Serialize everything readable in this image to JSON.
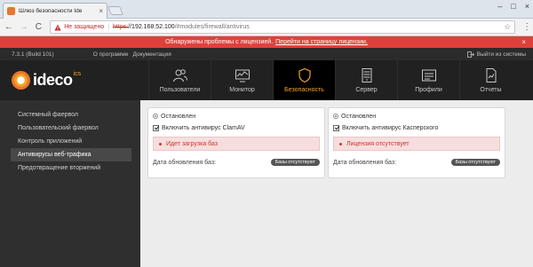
{
  "browser": {
    "tab_title": "Шлюз безопасности Ide",
    "tab_close": "×",
    "back": "←",
    "forward": "→",
    "reload": "C",
    "not_secure": "Не защищено",
    "separator": "|",
    "url_protocol": "https:",
    "url_host": "//192.168.52.100",
    "url_path": "/#modules/firewall/antivirus",
    "star": "☆",
    "menu": "⋮",
    "win_minimize": "–",
    "win_maximize": "□",
    "win_close": "×"
  },
  "alert": {
    "text": "Обнаружены проблемы с лицензией.",
    "link": "Перейти на страницу лицензии.",
    "close": "×"
  },
  "topbar": {
    "version": "7.3.1 (Build 101)",
    "about": "О программе",
    "docs": "Документация",
    "logout": "Выйти из системы"
  },
  "logo": {
    "text": "ideco",
    "suffix": "ics"
  },
  "nav": [
    {
      "label": "Пользователи",
      "icon": "users-icon"
    },
    {
      "label": "Монитор",
      "icon": "monitor-icon"
    },
    {
      "label": "Безопасность",
      "icon": "shield-icon",
      "active": true
    },
    {
      "label": "Сервер",
      "icon": "server-icon"
    },
    {
      "label": "Профили",
      "icon": "profiles-icon"
    },
    {
      "label": "Отчеты",
      "icon": "reports-icon"
    }
  ],
  "sidebar": {
    "items": [
      {
        "label": "Системный фаервол"
      },
      {
        "label": "Пользовательский фаервол"
      },
      {
        "label": "Контроль приложений"
      },
      {
        "label": "Антивирусы веб-трафика",
        "active": true
      },
      {
        "label": "Предотвращение вторжений"
      }
    ]
  },
  "panels": {
    "clamav": {
      "status": "Остановлен",
      "checkbox_label": "Включить антивирус ClamAV",
      "message": "Идет загрузка баз",
      "date_label": "Дата обновления баз:",
      "badge": "Базы отсутствуют"
    },
    "kaspersky": {
      "status": "Остановлен",
      "checkbox_label": "Включить антивирус Касперского",
      "message": "Лицензия отсутствует",
      "date_label": "Дата обновления баз:",
      "badge": "Базы отсутствуют"
    }
  },
  "colors": {
    "accent": "#f5a623",
    "alert": "#e0403c",
    "error_text": "#c0392b"
  }
}
